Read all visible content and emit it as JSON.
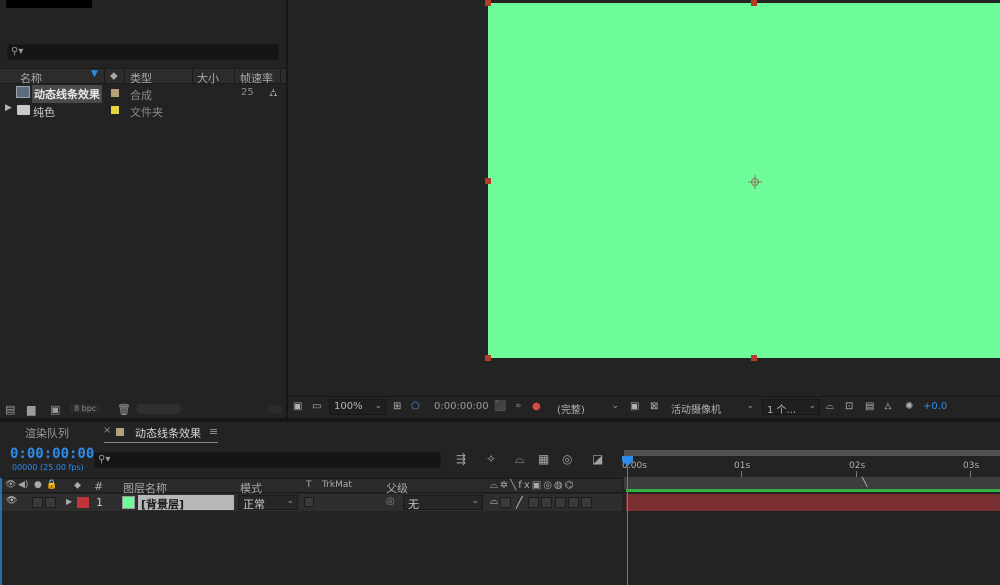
{
  "project": {
    "search_icon": "search-icon",
    "columns": {
      "name": "名称",
      "type": "类型",
      "size": "大小",
      "fps": "帧速率"
    },
    "items": [
      {
        "name": "动态线条效果",
        "type": "合成",
        "fps": "25",
        "swatch": "#b6a07a",
        "icon": "composition-icon"
      },
      {
        "name": "纯色",
        "type": "文件夹",
        "fps": "",
        "swatch": "#e6d23c",
        "icon": "folder-icon"
      }
    ],
    "bpc": "8 bpc"
  },
  "viewer": {
    "canvas_color": "#6efc9b",
    "zoom": "100%",
    "timecode": "0:00:00:00",
    "resolution": "(完整)",
    "camera": "活动摄像机",
    "views": "1 个...",
    "exposure": "+0.0"
  },
  "timeline": {
    "tabs": {
      "render_queue": "渲染队列",
      "comp": "动态线条效果",
      "close": "×",
      "menu": "≡"
    },
    "timecode": "0:00:00:00",
    "fps": "00000 (25.00 fps)",
    "columns": {
      "number": "#",
      "layer_name": "图层名称",
      "mode": "模式",
      "t": "T",
      "trkmat": "TrkMat",
      "parent": "父级"
    },
    "layer": {
      "index": "1",
      "name": "[背景层]",
      "mode": "正常",
      "parent": "无",
      "label_color": "#c0333a",
      "swatch": "#6efc9b"
    },
    "ruler": {
      "t0": "0:00s",
      "t1": "01s",
      "t2": "02s",
      "t3": "03s"
    }
  }
}
